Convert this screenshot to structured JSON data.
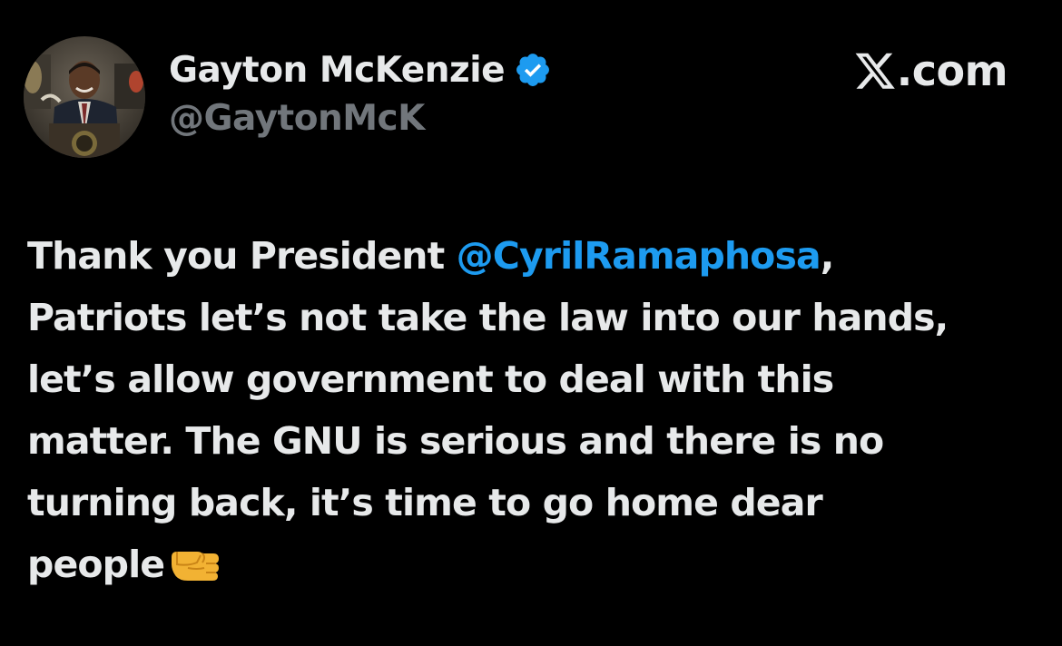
{
  "author": {
    "display_name": "Gayton McKenzie",
    "handle": "@GaytonMcK",
    "verified": true,
    "verified_icon": "verified-badge-icon",
    "verified_color": "#1d9bf0",
    "avatar": "profile-photo"
  },
  "source": {
    "logo_icon": "x-logo-icon",
    "domain": ".com"
  },
  "tweet": {
    "line1_before": "Thank you President ",
    "mention": "@CyrilRamaphosa",
    "line1_after": ",",
    "line2": "Patriots let’s not take the law into our hands,",
    "line3": "let’s allow government to deal with this",
    "line4": "matter. The GNU is serious and there is no",
    "line5": "turning back, it’s time to go home dear",
    "line6": "people",
    "emoji": "right-facing-fist-emoji",
    "mention_color": "#1d9bf0"
  },
  "colors": {
    "background": "#000000",
    "text": "#e7e9ea",
    "secondary_text": "#71767b"
  }
}
